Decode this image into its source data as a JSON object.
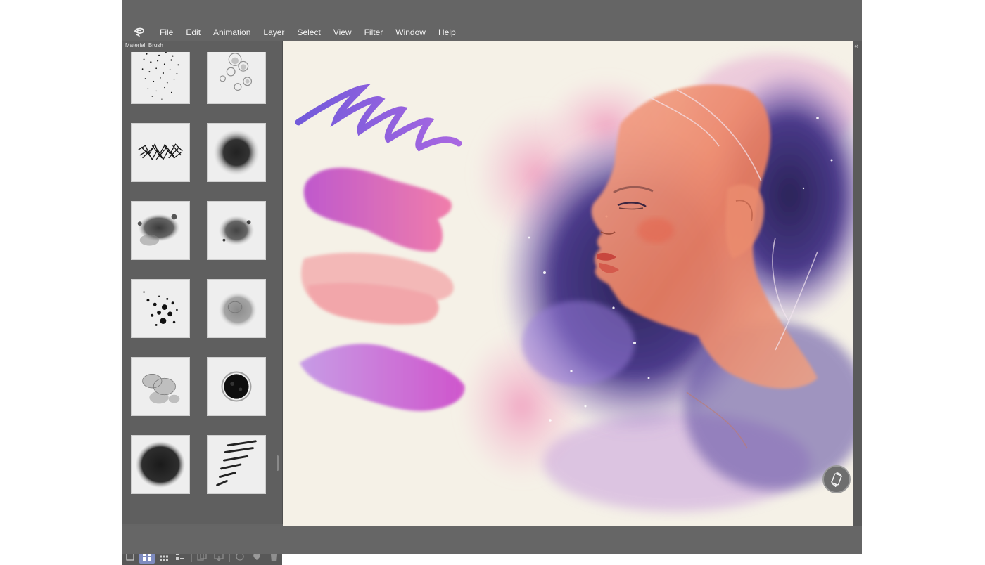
{
  "app": {
    "menu": [
      "File",
      "Edit",
      "Animation",
      "Layer",
      "Select",
      "View",
      "Filter",
      "Window",
      "Help"
    ]
  },
  "panel": {
    "title": "Material: Brush",
    "thumbnails": [
      {
        "name": "stipple-brush"
      },
      {
        "name": "soft-blob-brush"
      },
      {
        "name": "scribble-brush"
      },
      {
        "name": "round-soft-brush"
      },
      {
        "name": "wet-splatter-brush"
      },
      {
        "name": "cloud-brush"
      },
      {
        "name": "speckle-brush"
      },
      {
        "name": "gray-wash-brush"
      },
      {
        "name": "watercolor-bloom-brush"
      },
      {
        "name": "dark-spot-brush"
      },
      {
        "name": "ink-wash-brush"
      },
      {
        "name": "dash-stroke-brush"
      }
    ]
  },
  "toolbar": {
    "icons": [
      "panel-toggle-icon",
      "large-thumbnail-icon",
      "small-thumbnail-icon",
      "list-icon",
      "copy-icon",
      "import-icon",
      "refresh-icon",
      "favorite-icon",
      "delete-icon"
    ]
  },
  "colors": {
    "app_bg": "#656565",
    "canvas_bg": "#f5f1e7",
    "accent_selected": "#7e8bbf"
  }
}
